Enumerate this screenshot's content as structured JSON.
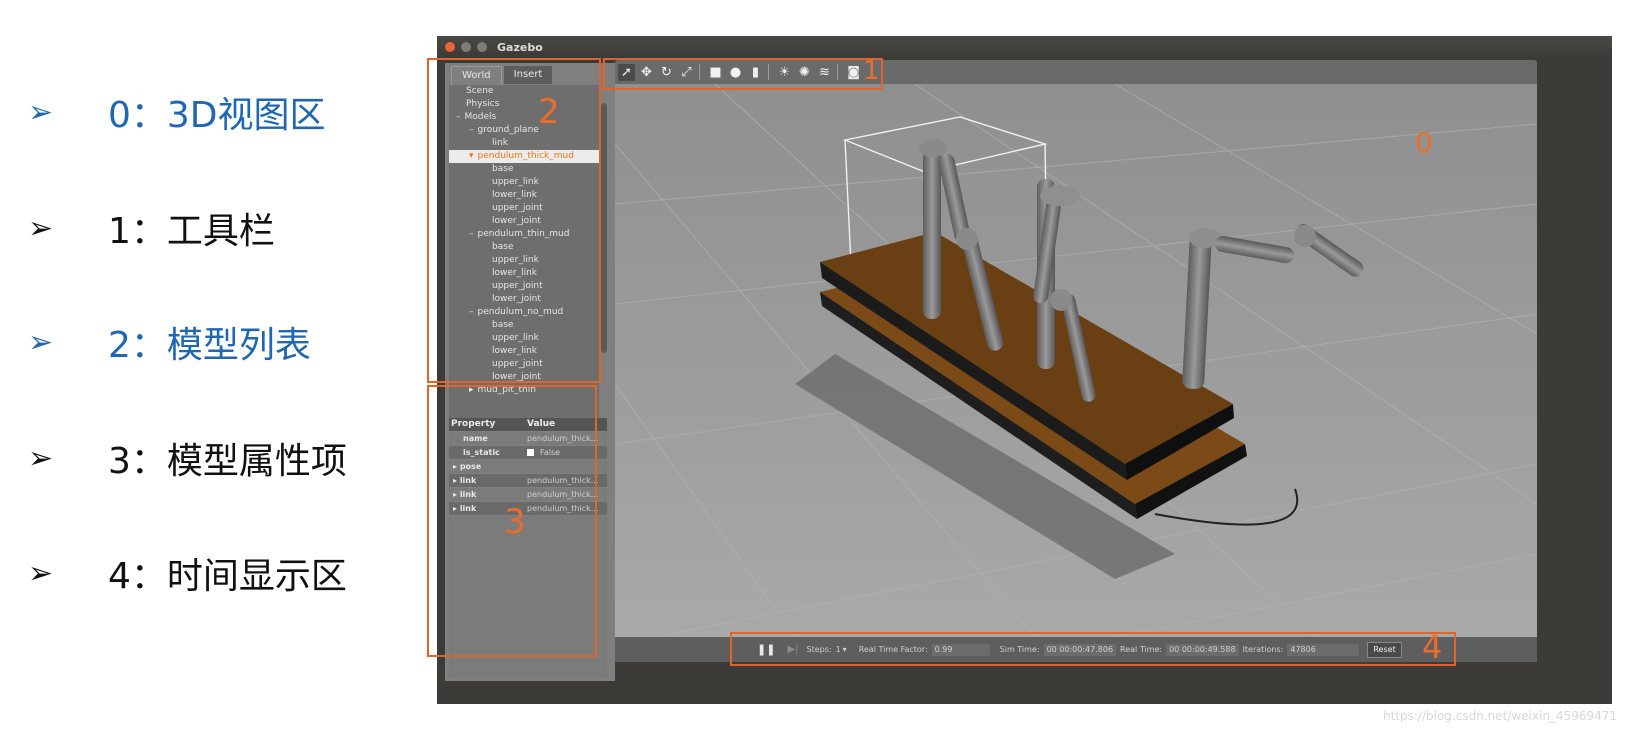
{
  "legend": [
    {
      "arrow": "➢",
      "label": "0：3D视图区",
      "color": "blue"
    },
    {
      "arrow": "➢",
      "label": "1：工具栏",
      "color": "black"
    },
    {
      "arrow": "➢",
      "label": "2：模型列表",
      "color": "blue"
    },
    {
      "arrow": "➢",
      "label": "3：模型属性项",
      "color": "black"
    },
    {
      "arrow": "➢",
      "label": "4：时间显示区",
      "color": "black"
    }
  ],
  "window": {
    "title": "Gazebo"
  },
  "tabs": [
    "World",
    "Insert"
  ],
  "tree": [
    {
      "label": "Scene",
      "indent": 1
    },
    {
      "label": "Physics",
      "indent": 1
    },
    {
      "label": "Models",
      "indent": 1,
      "prefix": "–"
    },
    {
      "label": "ground_plane",
      "indent": 2,
      "prefix": "–"
    },
    {
      "label": "link",
      "indent": 3
    },
    {
      "label": "pendulum_thick_mud",
      "indent": 2,
      "prefix": "▾",
      "selected": true
    },
    {
      "label": "base",
      "indent": 3
    },
    {
      "label": "upper_link",
      "indent": 3
    },
    {
      "label": "lower_link",
      "indent": 3
    },
    {
      "label": "upper_joint",
      "indent": 3
    },
    {
      "label": "lower_joint",
      "indent": 3
    },
    {
      "label": "pendulum_thin_mud",
      "indent": 2,
      "prefix": "–"
    },
    {
      "label": "base",
      "indent": 3
    },
    {
      "label": "upper_link",
      "indent": 3
    },
    {
      "label": "lower_link",
      "indent": 3
    },
    {
      "label": "upper_joint",
      "indent": 3
    },
    {
      "label": "lower_joint",
      "indent": 3
    },
    {
      "label": "pendulum_no_mud",
      "indent": 2,
      "prefix": "–"
    },
    {
      "label": "base",
      "indent": 3
    },
    {
      "label": "upper_link",
      "indent": 3
    },
    {
      "label": "lower_link",
      "indent": 3
    },
    {
      "label": "upper_joint",
      "indent": 3
    },
    {
      "label": "lower_joint",
      "indent": 3
    },
    {
      "label": "mud_pit_thin",
      "indent": 2,
      "prefix": "▸"
    }
  ],
  "properties": {
    "header": [
      "Property",
      "Value"
    ],
    "rows": [
      {
        "name": "name",
        "value": "pendulum_thick..."
      },
      {
        "name": "is_static",
        "value": "False",
        "checkbox": true
      },
      {
        "name": "pose",
        "value": "",
        "expand": true
      },
      {
        "name": "link",
        "value": "pendulum_thick...",
        "expand": true
      },
      {
        "name": "link",
        "value": "pendulum_thick...",
        "expand": true
      },
      {
        "name": "link",
        "value": "pendulum_thick...",
        "expand": true
      }
    ]
  },
  "toolbar": {
    "icons": [
      "select-arrow-icon",
      "translate-icon",
      "rotate-icon",
      "scale-icon",
      "box-icon",
      "sphere-icon",
      "cylinder-icon",
      "point-light-icon",
      "spot-light-icon",
      "directional-light-icon",
      "screenshot-icon"
    ]
  },
  "status": {
    "steps_label": "Steps:",
    "steps_value": "1",
    "rtf_label": "Real Time Factor:",
    "rtf_value": "0.99",
    "sim_label": "Sim Time:",
    "sim_value": "00 00:00:47.806",
    "real_label": "Real Time:",
    "real_value": "00 00:00:49.588",
    "iter_label": "Iterations:",
    "iter_value": "47806",
    "reset_label": "Reset"
  },
  "annotations": [
    "0",
    "1",
    "2",
    "3",
    "4"
  ],
  "accent": "#e86e2a",
  "watermark": "https://blog.csdn.net/weixin_45969471"
}
